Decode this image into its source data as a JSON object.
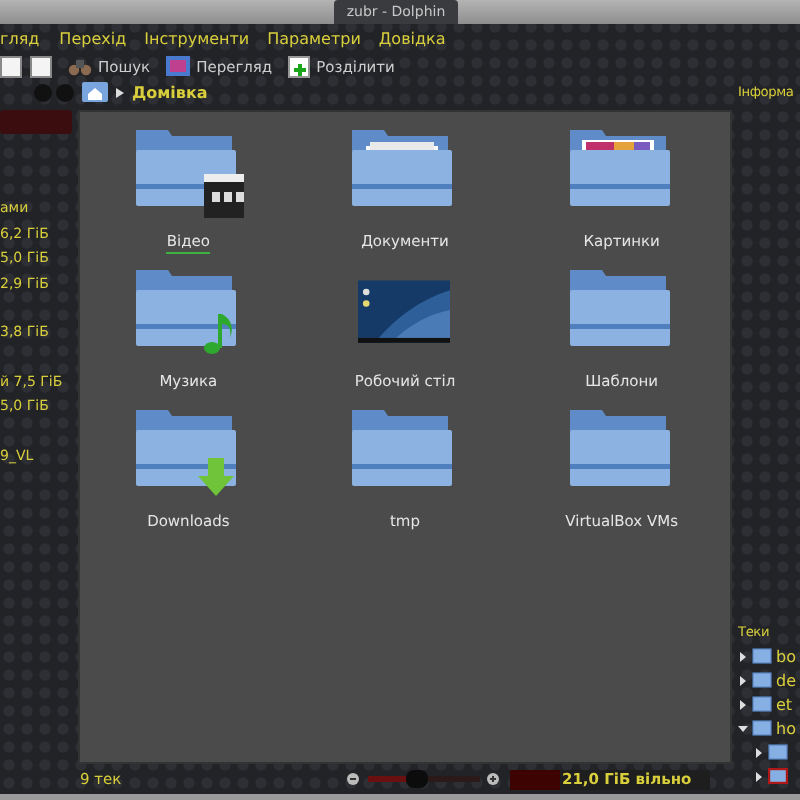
{
  "window": {
    "title": "zubr - Dolphin"
  },
  "menu": [
    "гляд",
    "Перехід",
    "Інструменти",
    "Параметри",
    "Довідка"
  ],
  "toolbar": [
    {
      "kind": "search",
      "label": "Пошук"
    },
    {
      "kind": "preview",
      "label": "Перегляд"
    },
    {
      "kind": "split",
      "label": "Розділити"
    }
  ],
  "places": [
    [
      "ами",
      "6,2 ГіБ",
      "5,0 ГіБ",
      "2,9 ГіБ"
    ],
    [
      "3,8 ГіБ"
    ],
    [
      "й 7,5 ГіБ",
      "5,0 ГіБ"
    ],
    [
      "9_VL"
    ]
  ],
  "location": {
    "breadcrumb": "Домівка"
  },
  "files": [
    {
      "name": "Відео",
      "kind": "video",
      "focused": true
    },
    {
      "name": "Документи",
      "kind": "documents",
      "focused": false
    },
    {
      "name": "Картинки",
      "kind": "pictures",
      "focused": false
    },
    {
      "name": "Музика",
      "kind": "music",
      "focused": false
    },
    {
      "name": "Робочий стіл",
      "kind": "desktop",
      "focused": false
    },
    {
      "name": "Шаблони",
      "kind": "folder",
      "focused": false
    },
    {
      "name": "Downloads",
      "kind": "downloads",
      "focused": false
    },
    {
      "name": "tmp",
      "kind": "folder",
      "focused": false
    },
    {
      "name": "VirtualBox VMs",
      "kind": "folder",
      "focused": false
    }
  ],
  "info_panel": {
    "title": "Інформа"
  },
  "folders_panel": {
    "title": "Теки",
    "tree": [
      {
        "label": "bo",
        "expanded": false
      },
      {
        "label": "de",
        "expanded": false
      },
      {
        "label": "et",
        "expanded": false
      },
      {
        "label": "ho",
        "expanded": true,
        "children": [
          {
            "selected": false
          },
          {
            "selected": true
          }
        ]
      }
    ]
  },
  "status_bar": {
    "count": "9 тек",
    "zoom": {
      "level": 0.43
    },
    "free_space": {
      "level": 0.25,
      "label": "21,0 ГіБ вільно"
    }
  }
}
